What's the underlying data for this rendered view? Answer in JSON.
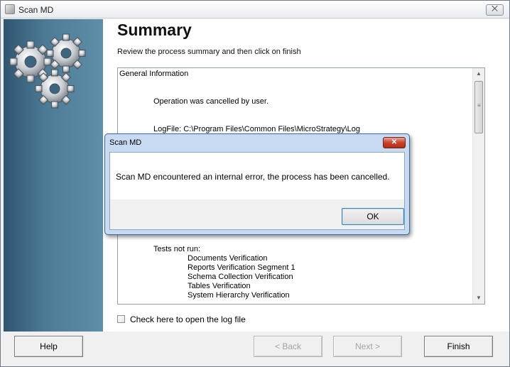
{
  "window": {
    "title": "Scan MD",
    "close_glyph": "⨉",
    "icon": "app-icon"
  },
  "page": {
    "title": "Summary",
    "subtitle": "Review the process summary and then click on finish"
  },
  "summary": {
    "general_info": "General Information",
    "cancelled": "Operation was cancelled by user.",
    "logfile": "LogFile: C:\\Program Files\\Common Files\\MicroStrategy\\Log",
    "tests_not_run": "Tests not run:",
    "tests": [
      "Documents Verification",
      "Reports Verification Segment 1",
      "Schema Collection Verification",
      "Tables Verification",
      "System Hierarchy Verification"
    ]
  },
  "scroll": {
    "up": "▲",
    "down": "▼"
  },
  "log_checkbox": {
    "label": "Check here to open the log file",
    "checked": false
  },
  "buttons": {
    "help": "Help",
    "back": "< Back",
    "next": "Next >",
    "finish": "Finish"
  },
  "dialog": {
    "title": "Scan MD",
    "close_glyph": "✕",
    "message": "Scan MD encountered an internal error, the process has been cancelled.",
    "ok": "OK"
  },
  "colors": {
    "sidebar": "#4e7c97",
    "dialog_frame": "#c7daf2",
    "dialog_close": "#c7432c"
  }
}
